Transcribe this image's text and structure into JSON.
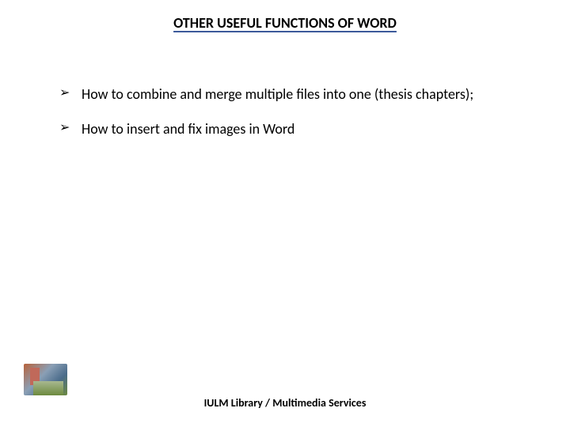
{
  "slide": {
    "title": "OTHER USEFUL FUNCTIONS OF WORD",
    "bullets": [
      "How to combine and merge multiple files into one (thesis chapters);",
      "How to insert and fix images in Word"
    ],
    "footer": "IULM Library / Multimedia Services"
  }
}
